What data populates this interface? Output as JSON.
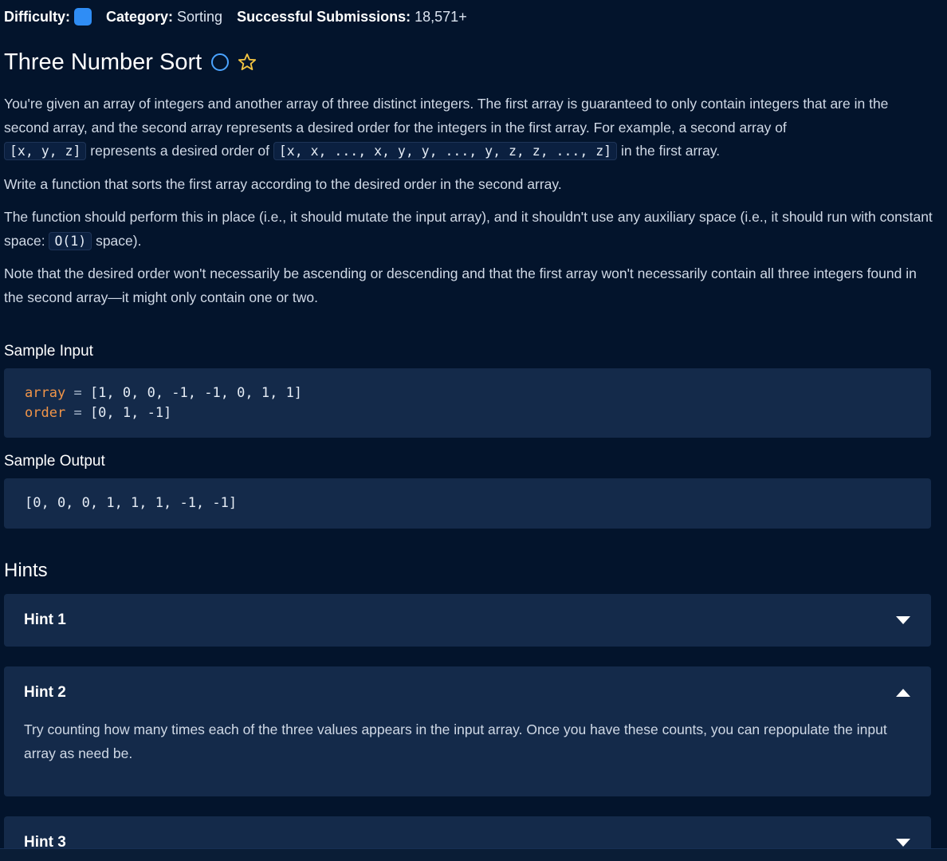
{
  "meta": {
    "difficulty_label": "Difficulty:",
    "category_label": "Category:",
    "category_value": "Sorting",
    "submissions_label": "Successful Submissions:",
    "submissions_value": "18,571+",
    "difficulty_color": "#2f8df5"
  },
  "problem": {
    "title": "Three Number Sort",
    "completion_icon": "circle-icon",
    "favorite_icon": "star-icon"
  },
  "description": {
    "p1_text_1": "You're given an array of integers and another array of three distinct integers. The first array is guaranteed to only contain integers that are in the second array, and the second array represents a desired order for the integers in the first array. For example, a second array of",
    "p1_code_1": "[x, y, z]",
    "p1_text_2": "represents a desired order of",
    "p1_code_2": "[x, x, ..., x, y, y, ..., y, z, z, ..., z]",
    "p1_text_3": "in the first array.",
    "p2": "Write a function that sorts the first array according to the desired order in the second array.",
    "p3_text_1": "The function should perform this in place (i.e., it should mutate the input array), and it shouldn't use any auxiliary space (i.e., it should run with constant space:",
    "p3_code": "O(1)",
    "p3_text_2": "space).",
    "p4": "Note that the desired order won't necessarily be ascending or descending and that the first array won't necessarily contain all three integers found in the second array—it might only contain one or two."
  },
  "sample_input": {
    "label": "Sample Input",
    "line1_var": "array",
    "line1_op": "=",
    "line1_val": "[1, 0, 0, -1, -1, 0, 1, 1]",
    "line2_var": "order",
    "line2_op": "=",
    "line2_val": "[0, 1, -1]"
  },
  "sample_output": {
    "label": "Sample Output",
    "value": "[0, 0, 0, 1, 1, 1, -1, -1]"
  },
  "hints": {
    "heading": "Hints",
    "items": [
      {
        "title": "Hint 1",
        "state": "collapsed"
      },
      {
        "title": "Hint 2",
        "state": "expanded",
        "body": "Try counting how many times each of the three values appears in the input array. Once you have these counts, you can repopulate the input array as need be."
      },
      {
        "title": "Hint 3",
        "state": "collapsed"
      }
    ]
  },
  "colors": {
    "background": "#03142c",
    "card": "#142a4a",
    "code_variable": "#f19549",
    "accent_blue": "#4aa3ff",
    "star": "#f4c542"
  }
}
